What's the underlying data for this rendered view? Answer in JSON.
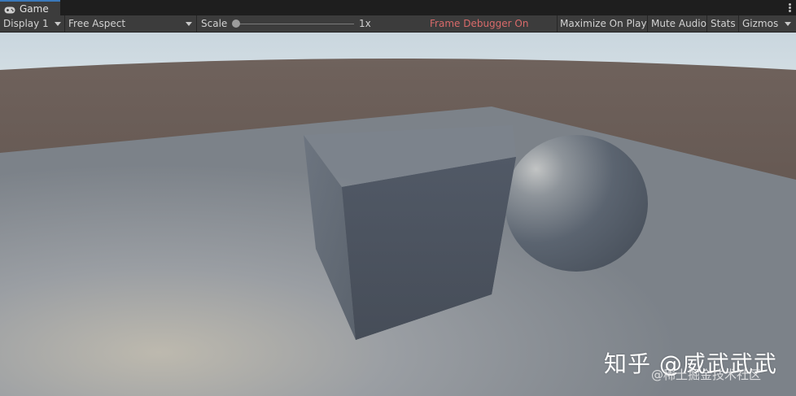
{
  "tab": {
    "title": "Game",
    "icon": "gamepad-icon"
  },
  "toolbar": {
    "display": "Display 1",
    "aspect": "Free Aspect",
    "scale_label": "Scale",
    "scale_value": "1x",
    "frame_debugger": "Frame Debugger On",
    "maximize": "Maximize On Play",
    "mute": "Mute Audio",
    "stats": "Stats",
    "gizmos": "Gizmos"
  },
  "watermark": {
    "main": "知乎 @威武武武",
    "sub": "@稀土掘金技术社区"
  },
  "colors": {
    "accent": "#3a79bb",
    "frame_debugger": "#d96a6a",
    "toolbar_bg": "#3c3c3c"
  }
}
